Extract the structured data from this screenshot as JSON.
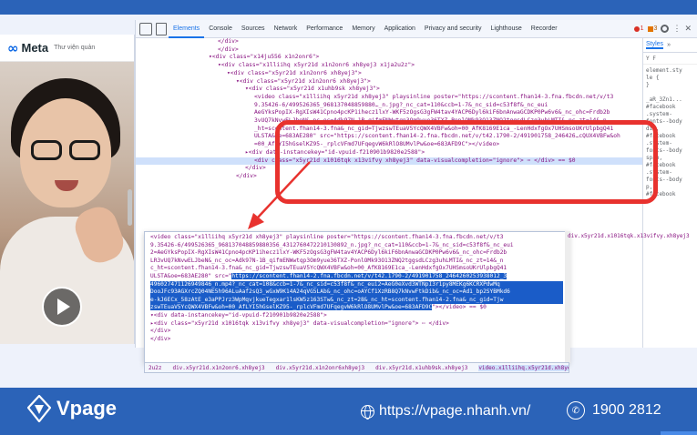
{
  "webpage": {
    "brand": "Meta",
    "subtitle": "Thư viện quản"
  },
  "devtools": {
    "tabs": [
      "Elements",
      "Console",
      "Sources",
      "Network",
      "Performance",
      "Memory",
      "Application",
      "Privacy and security",
      "Lighthouse",
      "Recorder"
    ],
    "active_tab": "Elements",
    "errors": "1",
    "warnings": "3",
    "styles_tabs": [
      "Styles",
      "»"
    ],
    "styles_filter": "Y F",
    "styles_lines": [
      "element.sty",
      "le {",
      "}",
      "",
      "_aR_3Zn1...",
      "#facebook",
      ".system-",
      "fonts--body",
      "div,",
      "#facebook",
      ".system-",
      "fonts--body",
      "span,",
      "#facebook",
      ".system-",
      "fonts--body",
      "p,",
      "#facebook"
    ]
  },
  "dom_lines": [
    {
      "indent": 18,
      "text": "</div>"
    },
    {
      "indent": 18,
      "text": "</div>"
    },
    {
      "indent": 16,
      "text": "▾<div class=\"x14ju556 x1n2onr6\">"
    },
    {
      "indent": 18,
      "text": "▾<div class=\"x1lliihq x5yr21d x1n2onr6 xh8yej3 x1ja2u2z\">"
    },
    {
      "indent": 20,
      "text": "▾<div class=\"x5yr21d x1n2onr6 xh8yej3\">"
    },
    {
      "indent": 22,
      "text": "▾<div class=\"x5yr21d x1n2onr6 xh8yej3\">"
    },
    {
      "indent": 24,
      "text": "▾<div class=\"x5yr21d x1uhb9sk xh8yej3\">"
    },
    {
      "indent": 26,
      "text": "<video class=\"x1lliihq x5yr21d xh8yej3\" playsinline poster=\"https://scontent.fhan14-3.fna.fbcdn.net/v/t3"
    },
    {
      "indent": 26,
      "text": "9.35426-6/499526365_968137048859880…_n.jpg?_nc_cat=110&ccb=1-7&_nc_sid=c53f8f&_nc_eui"
    },
    {
      "indent": 26,
      "text": "AeGYksPopIX-RgXIsW41Cpno4pcKP1ihecz1lxY-WKF5zOgsG3gFW4tav4YACP6Dyl6kiF6bnAnwaGCDKP0Pw6v6&_nc_ohc=Frdb2b"
    },
    {
      "indent": 26,
      "text": "3vUQ7kNvwELJbeN&_nc_oc=Adk97N-1B_qifmENWwtqp3Om9yue36TXZ-PonlOMk93O13ZNQ2tggsdLCzg3uhLMTI&_nc_zt=14&_n"
    },
    {
      "indent": 26,
      "text": "_ht=scontent.fhan14-3.fna&_nc_gid=TjwzswTEuaV5YcQWX4VBFw&oh=00_AfK8169E1ca_-LenHdxfgOx7UHSmsoUKrUlpbgQ41"
    },
    {
      "indent": 26,
      "text": "ULSTA&oe=683AE280\" src=\"https://scontent.fhan14-2.fna.fbcdn.net/v/t42.1790-2/491901758_246426…cQUX4VBFw&oh"
    },
    {
      "indent": 26,
      "text": "=00_AfLYI5hGselKZ95-_rplcVFmd7UFqegvW6kRlO8UMvlPw&oe=683AFD9C\"></video>"
    },
    {
      "indent": 24,
      "text": "▸<div data-instancekey=\"id-vpuid-f210901b9820e2588\">"
    },
    {
      "indent": 26,
      "text": "<div class=\"x5yr21d x1016tqk x13vifvy xh8yej3\" data-visualcompletion=\"ignore\"> ⋯ </div> == $0"
    },
    {
      "indent": 24,
      "text": "</div>"
    },
    {
      "indent": 22,
      "text": "</div>"
    }
  ],
  "zoom_lines": [
    {
      "text": "<video class=\"x1lliihq x5yr21d xh8yej3\" playsinline poster=\"https://scontent.fhan14-3.fna.fbcdn.net/v/t3",
      "sel": "none"
    },
    {
      "text": "9.35426-6/499526365_968137048859880356_4312760472210130892_n.jpg?_nc_cat=110&ccb=1-7&_nc_sid=c53f8f&_nc_eui",
      "sel": "none"
    },
    {
      "text": "2=AeGYksPopIX-RgXIsW41Cpno4pcKP1ihecz1lxY-WKF5zOgsG3gFW4tav4YACP6Dyl6kiF6bnAnwaGCDKP0Pw6v6&_nc_ohc=Frdb2b",
      "sel": "none"
    },
    {
      "text": "LR3vUQ7kNvwELJbeN&_nc_oc=Adk97N-1B_qifmENWwtqp3Om9yue36TXZ-PonlOMk93O13ZNQ2tggsdLCzg3uhLMTI&_nc_zt=14&_n",
      "sel": "none"
    },
    {
      "text": "c_ht=scontent.fhan14-3.fna&_nc_gid=TjwzswTEuaV5YcQWX4VBFw&oh=00_AfK8169E1ca_-LenHdxfgOx7UHSmsoUKrUlpbgQ41",
      "sel": "none"
    },
    {
      "text": "ULSTA&oe=683AE280\" src=\"https://scontent.fhan14-2.fna.fbcdn.net/v/t42.1790-2/491901758_2464260253938012_3",
      "sel": "partial"
    },
    {
      "text": "496027471126949846_n.mp4?_nc_cat=108&ccb=1-7&_nc_sid=c53f8f&_nc_eui2=AeG0eXvd3WTNpI3r1py8MEKg6KCRXPdwMq",
      "sel": "full"
    },
    {
      "text": "DooJFc93AGXrcZQ04NE5h96ALuAaf2sQ3_wGxW9K14A24qVG5LAb&_nc_ohc=oAYCf1XzRB8Q7kNvwFtkDib&_nc_oc=Ad1_bp2SYBMkd6",
      "sel": "full"
    },
    {
      "text": "e-kJ6ECx_58zAtE_e3aPPJrz3WpMqvjkueTegxar1lsKW5z163STw&_nc_zt=28&_nc_ht=scontent.fhan14-2.fna&_nc_gid=Tjw",
      "sel": "full"
    },
    {
      "text": "zswTEuaV5YcQWX4VBFw&oh=00_AfLYI5hGselKZ95-_rplcVFmd7UFqegvW6kRlO8UMvlPw&oe=683AFD9C\"></video> == $0",
      "sel": "end"
    },
    {
      "text": "▾<div data-instancekey=\"id-vpuid-f210901b9820e2588\">",
      "sel": "none"
    },
    {
      "text": "  ▸<div class=\"x5yr21d x1016tqk x13vifvy xh8yej3\" data-visualcompletion=\"ignore\"> ⋯ </div>",
      "sel": "none"
    },
    {
      "text": "  </div>",
      "sel": "none"
    },
    {
      "text": "</div>",
      "sel": "none"
    }
  ],
  "zoom_bread": [
    "2u2z",
    "div.x5yr21d.x1n2onr6.xh8yej3",
    "div.x5yr21d.x1n2onr6xh8yej3",
    "div.x5yr21d.x1uhb9sk.xh8yej3",
    "video.x1lliihq.x5yr21d.xh8yej3"
  ],
  "panel_bread": [
    "div.x5yr21d.x1016tqk.x13vifvy.xh8yej3"
  ],
  "footer": {
    "brand": "Vpage",
    "website": "https://vpage.nhanh.vn/",
    "phone": "1900 2812"
  },
  "colors": {
    "accent": "#1a73e8",
    "highlight": "#e8322e",
    "footer": "#2b63b8"
  }
}
